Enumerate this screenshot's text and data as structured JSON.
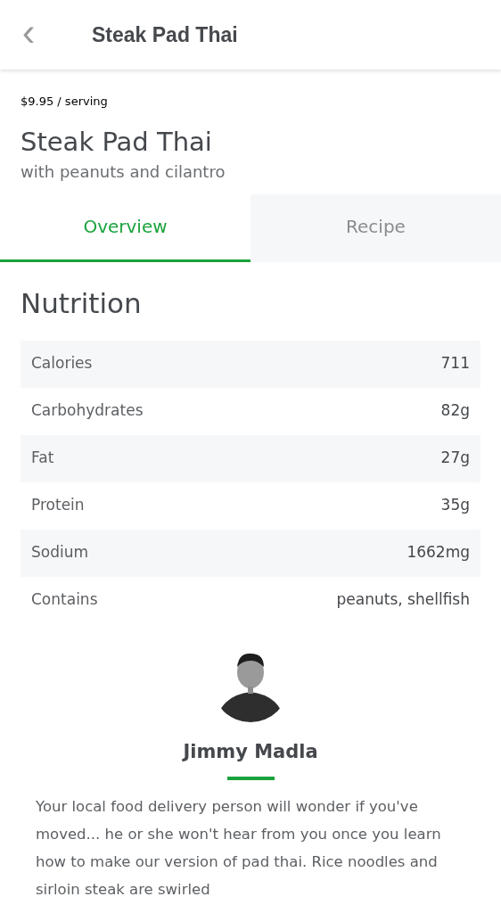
{
  "header": {
    "back_icon": "‹",
    "title": "Steak Pad Thai"
  },
  "price": "$9.95 / serving",
  "recipe": {
    "title": "Steak Pad Thai",
    "subtitle": "with peanuts and cilantro"
  },
  "tabs": [
    {
      "label": "Overview",
      "selected": true
    },
    {
      "label": "Recipe",
      "selected": false
    }
  ],
  "nutrition": {
    "heading": "Nutrition",
    "rows": [
      {
        "label": "Calories",
        "value": "711"
      },
      {
        "label": "Carbohydrates",
        "value": "82g"
      },
      {
        "label": "Fat",
        "value": "27g"
      },
      {
        "label": "Protein",
        "value": "35g"
      },
      {
        "label": "Sodium",
        "value": "1662mg"
      },
      {
        "label": "Contains",
        "value": "peanuts, shellfish"
      }
    ]
  },
  "chef": {
    "name": "Jimmy Madla",
    "description": "Your local food delivery person will wonder if you've moved... he or she won't hear from you once you learn how to make our version of pad thai. Rice noodles and sirloin steak are swirled"
  }
}
